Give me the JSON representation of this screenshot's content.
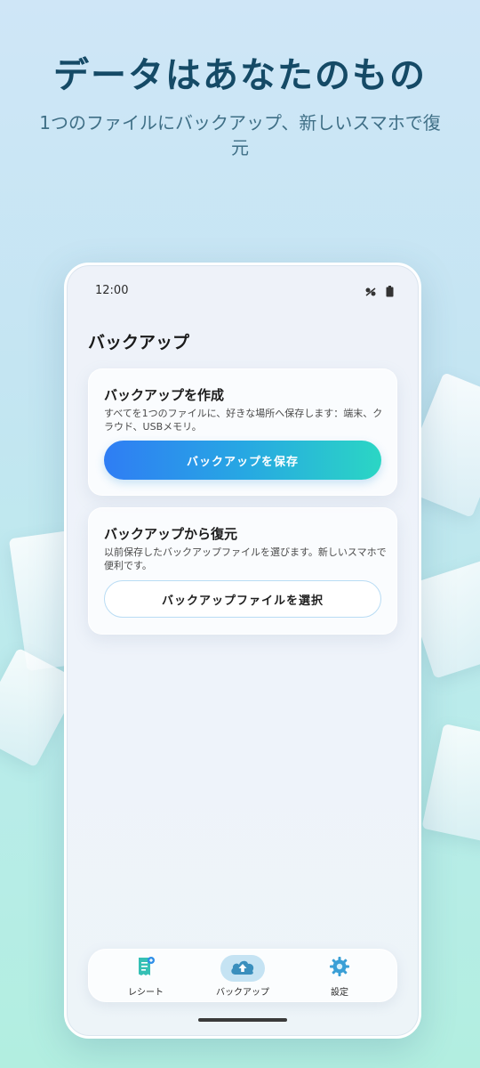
{
  "hero": {
    "title": "データはあなたのもの",
    "subtitle": "1つのファイルにバックアップ、新しいスマホで復元"
  },
  "status_bar": {
    "time": "12:00",
    "icons": [
      "signal-icon",
      "battery-icon"
    ]
  },
  "page": {
    "title": "バックアップ"
  },
  "create_card": {
    "title": "バックアップを作成",
    "description": "すべてを1つのファイルに、好きな場所へ保存します：端末、クラウド、USBメモリ。",
    "button_label": "バックアップを保存"
  },
  "restore_card": {
    "title": "バックアップから復元",
    "description": "以前保存したバックアップファイルを選びます。新しいスマホで便利です。",
    "button_label": "バックアップファイルを選択"
  },
  "bottom_nav": {
    "items": [
      {
        "label": "レシート",
        "icon": "receipt-icon",
        "active": false
      },
      {
        "label": "バックアップ",
        "icon": "cloud-upload-icon",
        "active": true
      },
      {
        "label": "設定",
        "icon": "gear-icon",
        "active": false
      }
    ]
  },
  "colors": {
    "accent_start": "#2f7df4",
    "accent_end": "#2bd6c4",
    "title": "#154a66"
  }
}
